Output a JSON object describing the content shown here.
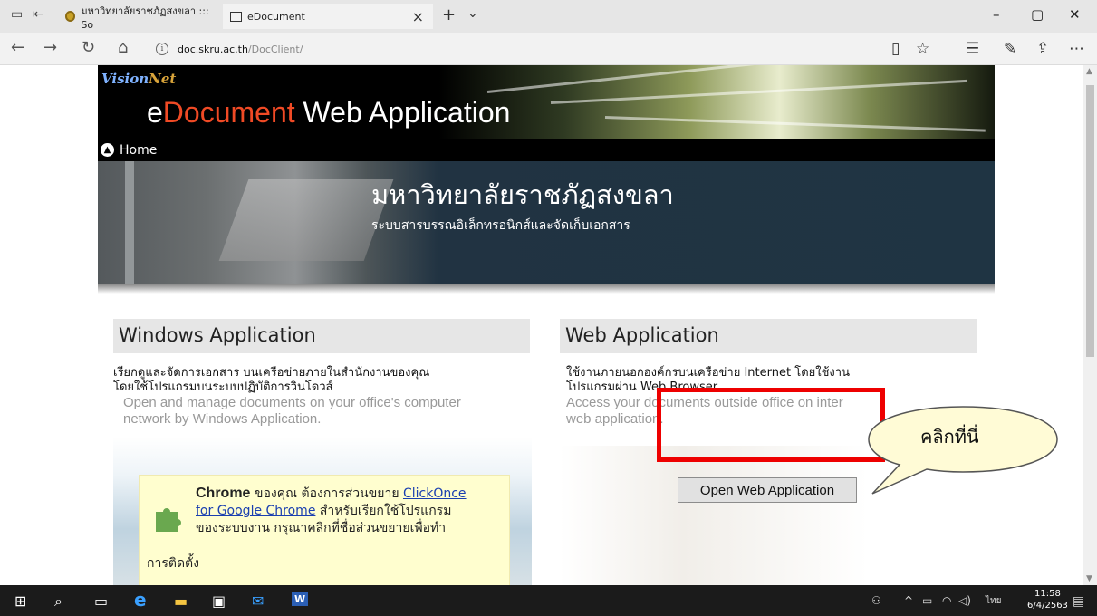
{
  "browser": {
    "tabs": [
      {
        "title": "มหาวิทยาลัยราชภัฏสงขลา ::: So"
      },
      {
        "title": "eDocument"
      }
    ],
    "url_host": "doc.skru.ac.th",
    "url_path": "/DocClient/"
  },
  "header": {
    "logo_part1": "Vision",
    "logo_part2": "Net",
    "app_title_e": "e",
    "app_title_doc": "Document",
    "app_title_rest": " Web Application",
    "home_label": "Home",
    "university_name": "มหาวิทยาลัยราชภัฏสงขลา",
    "university_subtitle": "ระบบสารบรรณอิเล็กทรอนิกส์และจัดเก็บเอกสาร"
  },
  "windows_app": {
    "heading": "Windows Application",
    "desc_th_1": "เรียกดูและจัดการเอกสาร บนเครือข่ายภายในสำนักงานของคุณ",
    "desc_th_2": "โดยใช้โปรแกรมบนระบบปฏิบัติการวินโดวส์",
    "desc_en_1": "Open and manage documents on your office's computer",
    "desc_en_2": "network by Windows Application.",
    "chrome_bold": "Chrome",
    "chrome_text_1": " ของคุณ ต้องการส่วนขยาย ",
    "chrome_link_1": "ClickOnce",
    "chrome_link_2": "for Google Chrome",
    "chrome_text_2": " สำหรับเรียกใช้โปรแกรม",
    "chrome_text_3": "ของระบบงาน กรุณาคลิกที่ชื่อส่วนขยายเพื่อทำ",
    "chrome_text_4": "การติดตั้ง"
  },
  "web_app": {
    "heading": "Web Application",
    "desc_th_1": "ใช้งานภายนอกองค์กรบนเครือข่าย Internet โดยใช้งาน",
    "desc_th_2": "โปรแกรมผ่าน Web Browser",
    "desc_en_1": "Access your documents outside office on inter",
    "desc_en_2": "web application.",
    "open_button": "Open Web Application"
  },
  "annotation": {
    "callout_text": "คลิกที่นี่",
    "highlight_color": "#ee0000"
  },
  "taskbar": {
    "lang": "ไทย",
    "time": "11:58",
    "date": "6/4/2563"
  },
  "colors": {
    "accent_document": "#f04a25",
    "hero_bg": "#1f3443"
  }
}
